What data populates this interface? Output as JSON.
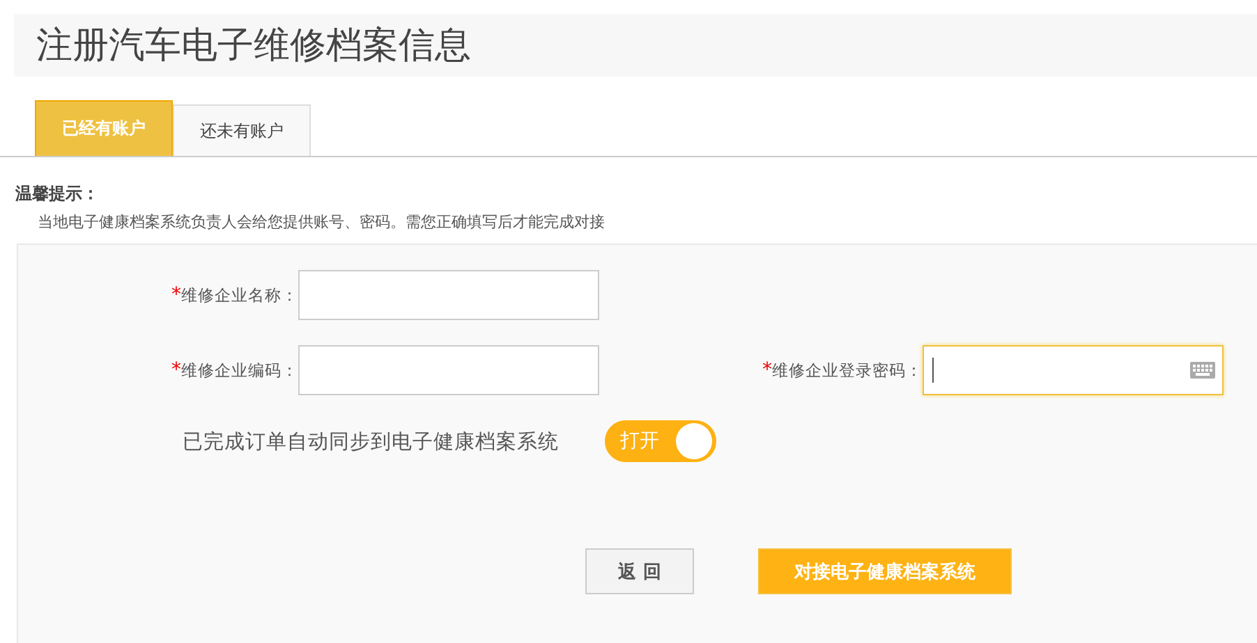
{
  "title": "注册汽车电子维修档案信息",
  "tabs": [
    {
      "label": "已经有账户",
      "selected": true
    },
    {
      "label": "还未有账户",
      "selected": false
    }
  ],
  "tip": {
    "heading": "温馨提示：",
    "text": "当地电子健康档案系统负责人会给您提供账号、密码。需您正确填写后才能完成对接"
  },
  "form_rows": [
    [
      {
        "required_mark": "*",
        "label": "维修企业名称：",
        "kind": "text",
        "focused": false
      }
    ],
    [
      {
        "required_mark": "*",
        "label": "维修企业编码：",
        "kind": "text",
        "focused": false
      },
      {
        "required_mark": "*",
        "label": "维修企业登录密码：",
        "kind": "password",
        "focused": true
      }
    ]
  ],
  "sync": {
    "label": "已完成订单自动同步到电子健康档案系统",
    "switch_text": "打开",
    "on": true
  },
  "buttons": [
    {
      "label": "返 回",
      "kind": "secondary"
    },
    {
      "label": "对接电子健康档案系统",
      "kind": "primary"
    }
  ]
}
